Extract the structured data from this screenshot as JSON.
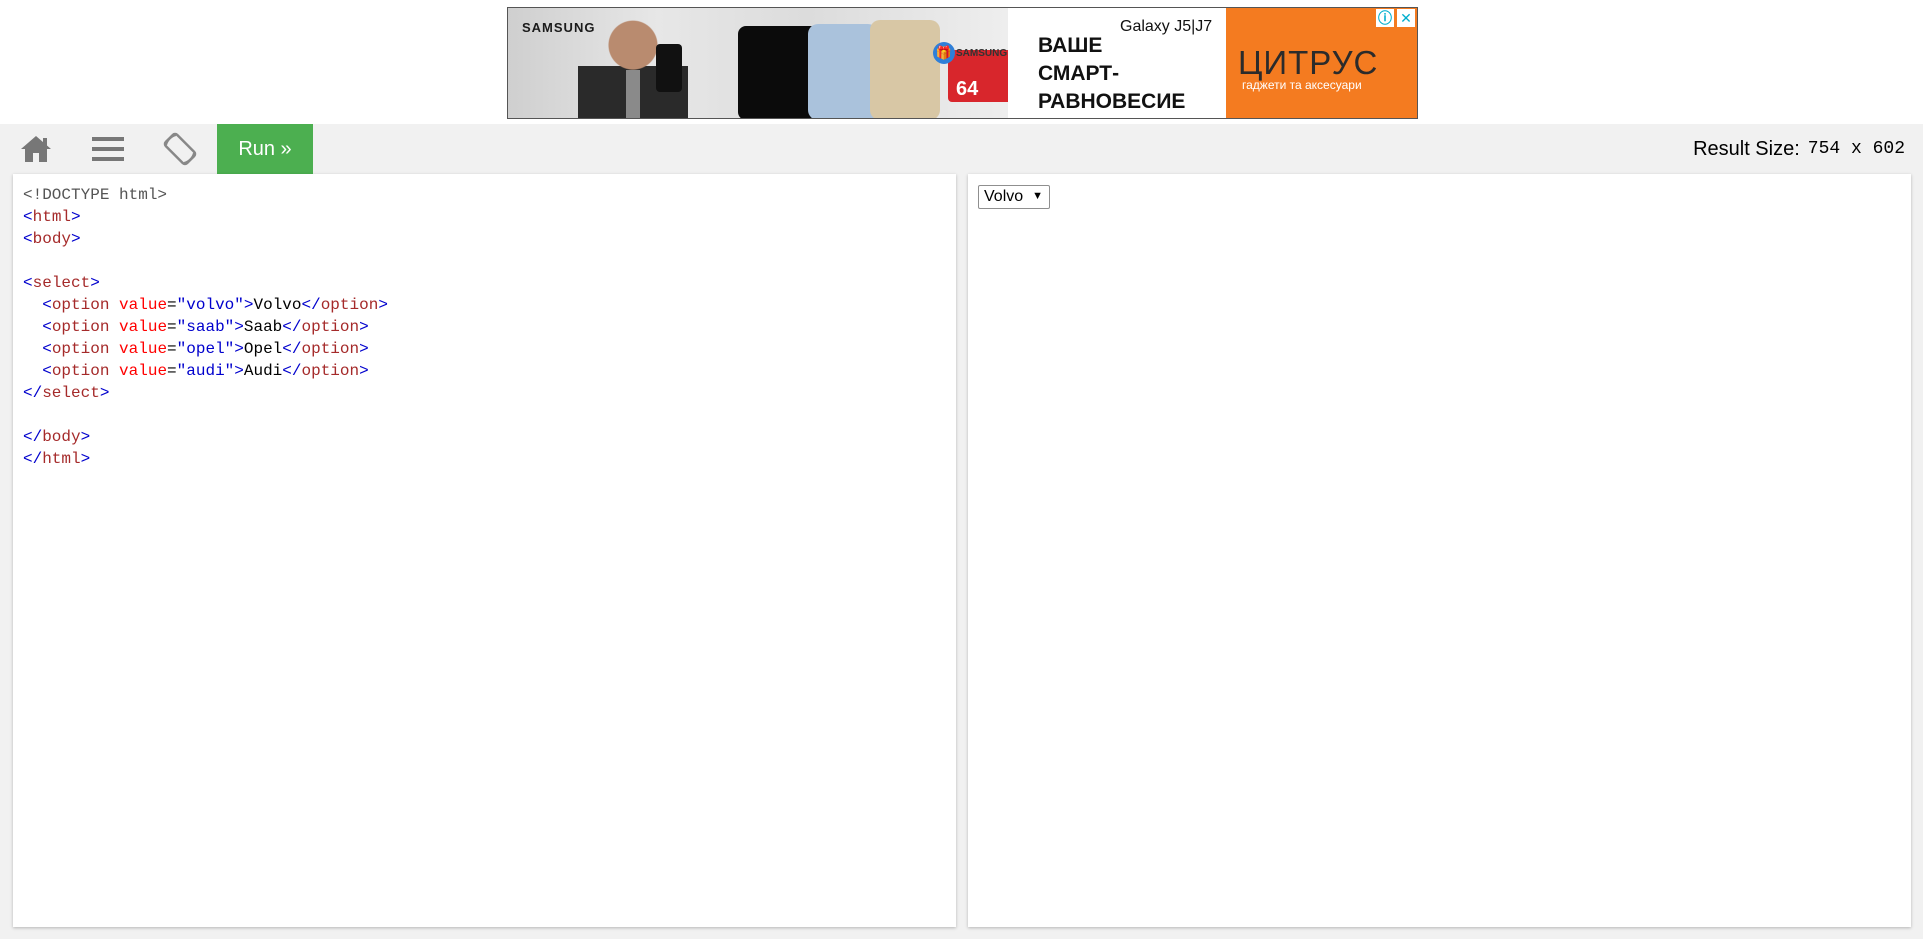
{
  "ad": {
    "brand": "SAMSUNG",
    "model": "Galaxy J5|J7",
    "card_brand": "SAMSUNG",
    "card_capacity": "64",
    "slogan": "ВАШЕ\nСМАРТ-\nРАВНОВЕСИЕ",
    "logo": "ЦИТРУС",
    "logo_sub": "гаджети та аксесуари",
    "info_icon": "info-icon",
    "close_icon": "close-icon"
  },
  "toolbar": {
    "home_icon": "home-icon",
    "menu_icon": "menu-icon",
    "rotate_icon": "rotate-icon",
    "run_label": "Run »",
    "result_size_label": "Result Size:",
    "result_size_value": "754 x 602",
    "run_color": "#4caf50"
  },
  "code": {
    "lines": [
      "<!DOCTYPE html>",
      "<html>",
      "<body>",
      "",
      "<select>",
      "  <option value=\"volvo\">Volvo</option>",
      "  <option value=\"saab\">Saab</option>",
      "  <option value=\"opel\">Opel</option>",
      "  <option value=\"audi\">Audi</option>",
      "</select>",
      "",
      "</body>",
      "</html>"
    ]
  },
  "result": {
    "select_value": "Volvo",
    "select_arrow": "▼"
  }
}
